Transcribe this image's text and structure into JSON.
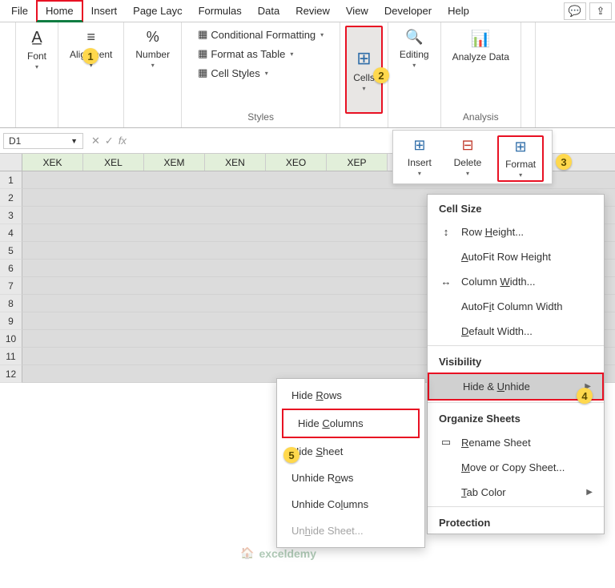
{
  "tabs": [
    "File",
    "Home",
    "Insert",
    "Page Layc",
    "Formulas",
    "Data",
    "Review",
    "View",
    "Developer",
    "Help"
  ],
  "active_tab": "Home",
  "ribbon": {
    "font": "Font",
    "alignment": "Alignment",
    "number": "Number",
    "styles_label": "Styles",
    "cond_fmt": "Conditional Formatting",
    "format_table": "Format as Table",
    "cell_styles": "Cell Styles",
    "cells": "Cells",
    "editing": "Editing",
    "analyze": "Analyze Data",
    "analysis_label": "Analysis"
  },
  "name_box": "D1",
  "cellpanel": {
    "insert": "Insert",
    "delete": "Delete",
    "format": "Format"
  },
  "columns": [
    "XEK",
    "XEL",
    "XEM",
    "XEN",
    "XEO",
    "XEP"
  ],
  "rows": [
    1,
    2,
    3,
    4,
    5,
    6,
    7,
    8,
    9,
    10,
    11,
    12
  ],
  "format_menu": {
    "cell_size": "Cell Size",
    "row_height": "Row Height...",
    "autofit_row": "AutoFit Row Height",
    "col_width": "Column Width...",
    "autofit_col": "AutoFit Column Width",
    "default_w": "Default Width...",
    "visibility": "Visibility",
    "hide_unhide": "Hide & Unhide",
    "organize": "Organize Sheets",
    "rename": "Rename Sheet",
    "move_copy": "Move or Copy Sheet...",
    "tab_color": "Tab Color",
    "protection": "Protection"
  },
  "hide_menu": {
    "hide_rows": "Hide Rows",
    "hide_cols": "Hide Columns",
    "hide_sheet": "Hide Sheet",
    "unhide_rows": "Unhide Rows",
    "unhide_cols": "Unhide Columns",
    "unhide_sheet": "Unhide Sheet..."
  },
  "watermark": "exceldemy",
  "badges": {
    "1": "1",
    "2": "2",
    "3": "3",
    "4": "4",
    "5": "5"
  }
}
